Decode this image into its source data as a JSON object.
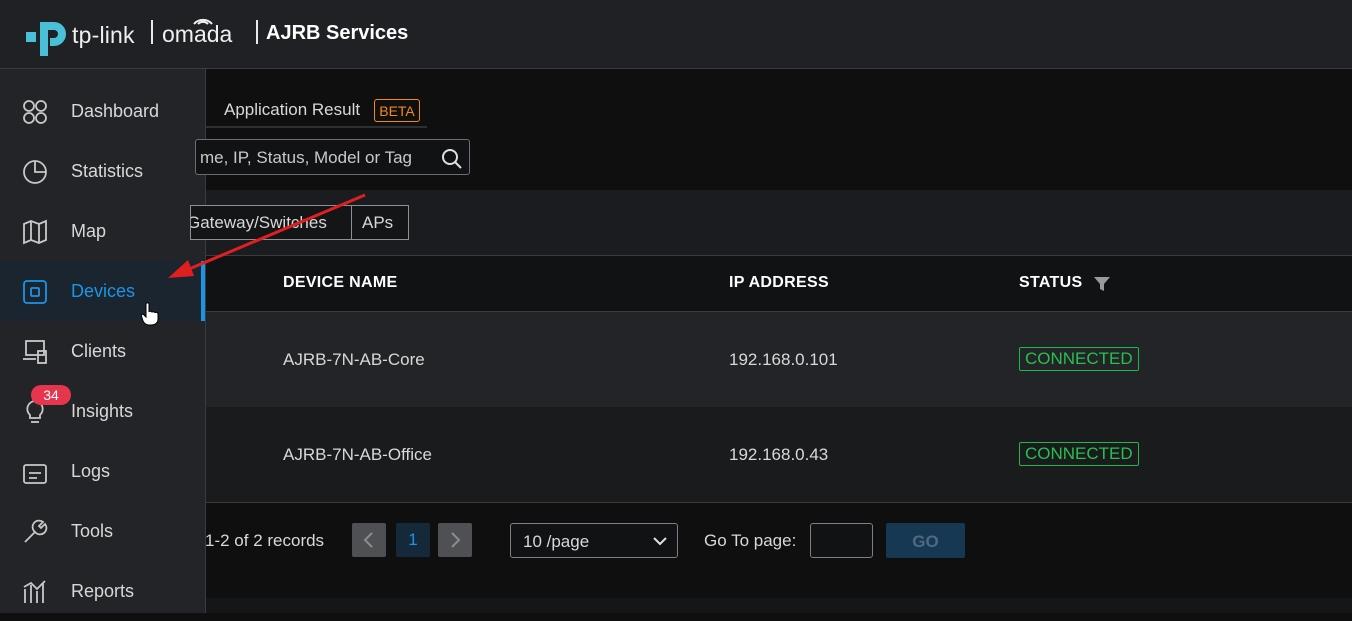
{
  "header": {
    "brand": "tp-link",
    "product": "omada",
    "site_name": "AJRB Services"
  },
  "sidebar": {
    "items": [
      {
        "label": "Dashboard",
        "icon": "dashboard-icon"
      },
      {
        "label": "Statistics",
        "icon": "pie-chart-icon"
      },
      {
        "label": "Map",
        "icon": "map-icon"
      },
      {
        "label": "Devices",
        "icon": "devices-icon",
        "active": true
      },
      {
        "label": "Clients",
        "icon": "clients-icon"
      },
      {
        "label": "Insights",
        "icon": "lightbulb-icon"
      },
      {
        "label": "Logs",
        "icon": "logs-icon",
        "badge": "34"
      },
      {
        "label": "Tools",
        "icon": "wrench-icon"
      },
      {
        "label": "Reports",
        "icon": "reports-icon"
      }
    ]
  },
  "tabs": {
    "application_result": "Application Result",
    "beta": "BETA"
  },
  "search": {
    "placeholder": "me, IP, Status, Model or Tag"
  },
  "filters": {
    "gateway_switches": "Gateway/Switches",
    "aps": "APs"
  },
  "table": {
    "columns": [
      "DEVICE NAME",
      "IP ADDRESS",
      "STATUS"
    ],
    "rows": [
      {
        "device_name": "AJRB-7N-AB-Core",
        "ip": "192.168.0.101",
        "status": "CONNECTED"
      },
      {
        "device_name": "AJRB-7N-AB-Office",
        "ip": "192.168.0.43",
        "status": "CONNECTED"
      }
    ]
  },
  "pagination": {
    "records": "1-2 of 2 records",
    "current_page": "1",
    "page_size": "10 /page",
    "goto_label": "Go To page:",
    "go_label": "GO"
  },
  "colors": {
    "accent": "#1a95e6",
    "status_connected": "#27c04f",
    "beta_orange": "#f08a1c",
    "annotation_arrow": "#e02020"
  }
}
